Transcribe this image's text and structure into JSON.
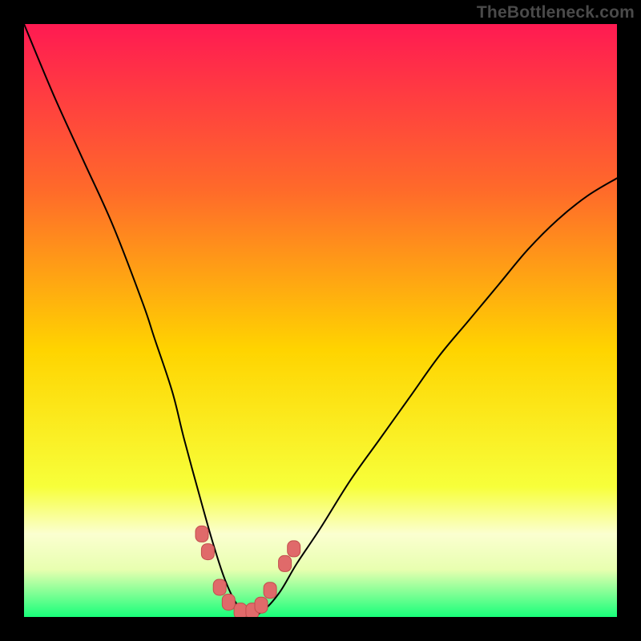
{
  "watermark": "TheBottleneck.com",
  "colors": {
    "frame": "#000000",
    "gradient_top": "#ff1a52",
    "gradient_upper_mid": "#ff6a2a",
    "gradient_mid": "#ffd400",
    "gradient_lower_mid": "#f7ff3a",
    "gradient_band_pale": "#fbffd0",
    "gradient_bottom": "#18ff7a",
    "curve_stroke": "#000000",
    "marker_fill": "#e06a6a",
    "marker_stroke": "#c24d4d"
  },
  "chart_data": {
    "type": "line",
    "title": "",
    "xlabel": "",
    "ylabel": "",
    "xlim": [
      0,
      100
    ],
    "ylim": [
      0,
      100
    ],
    "notes": "Bottleneck chart. Background is a vertical red→orange→yellow→green gradient. A black V-shaped curve descends from top-left, reaches a minimum near x≈37, and rises toward the right edge. Salmon rounded markers sit along the curve near the trough.",
    "series": [
      {
        "name": "bottleneck-curve",
        "x": [
          0,
          5,
          10,
          15,
          20,
          22,
          25,
          27,
          30,
          32,
          34,
          36,
          38,
          40,
          43,
          46,
          50,
          55,
          60,
          65,
          70,
          75,
          80,
          85,
          90,
          95,
          100
        ],
        "values": [
          100,
          88,
          77,
          66,
          53,
          47,
          38,
          30,
          19,
          12,
          6,
          2,
          0.5,
          0.8,
          4,
          9,
          15,
          23,
          30,
          37,
          44,
          50,
          56,
          62,
          67,
          71,
          74
        ]
      }
    ],
    "markers": [
      {
        "x": 30.0,
        "y": 14.0
      },
      {
        "x": 31.0,
        "y": 11.0
      },
      {
        "x": 33.0,
        "y": 5.0
      },
      {
        "x": 34.5,
        "y": 2.5
      },
      {
        "x": 36.5,
        "y": 1.0
      },
      {
        "x": 38.5,
        "y": 1.0
      },
      {
        "x": 40.0,
        "y": 2.0
      },
      {
        "x": 41.5,
        "y": 4.5
      },
      {
        "x": 44.0,
        "y": 9.0
      },
      {
        "x": 45.5,
        "y": 11.5
      }
    ]
  }
}
